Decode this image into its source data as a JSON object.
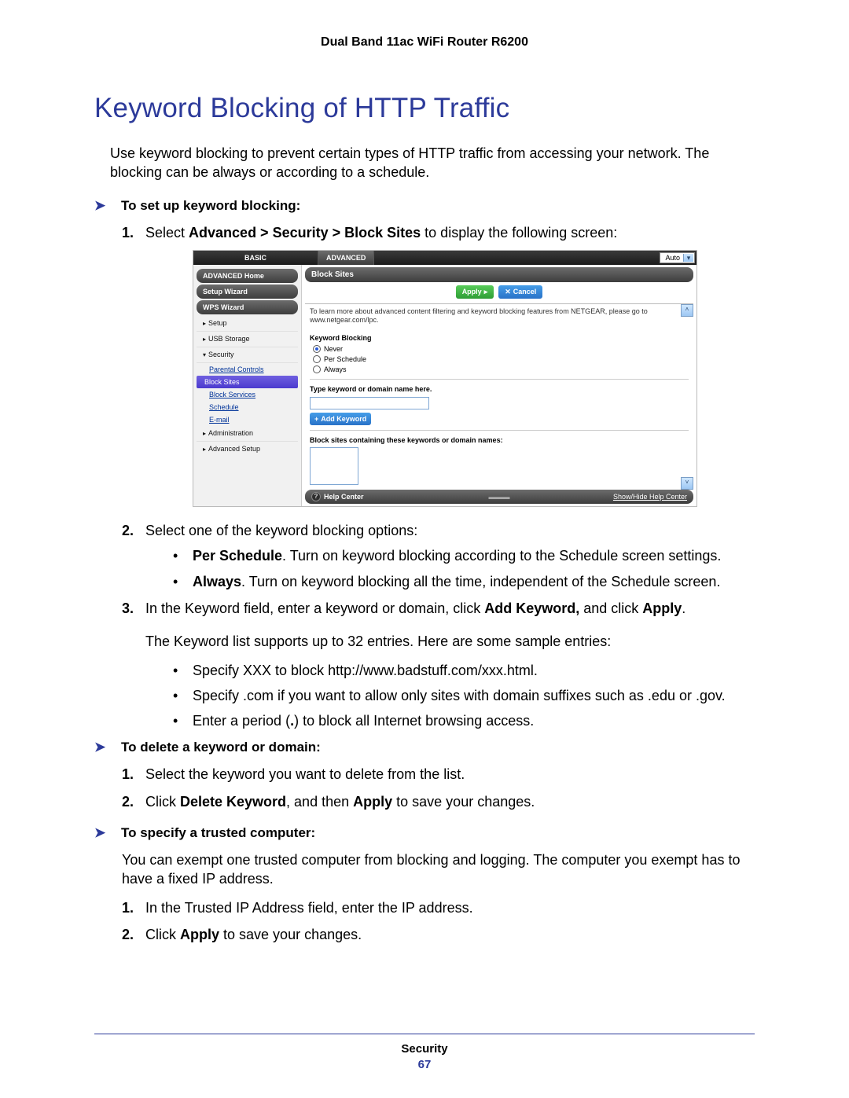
{
  "header": {
    "product": "Dual Band 11ac WiFi Router R6200"
  },
  "title": "Keyword Blocking of HTTP Traffic",
  "intro": "Use keyword blocking to prevent certain types of HTTP traffic from accessing your network. The blocking can be always or according to a schedule.",
  "proc1": {
    "heading": "To set up keyword blocking:",
    "step1_pre": "Select ",
    "step1_bold": "Advanced > Security > Block Sites",
    "step1_post": " to display the following screen:",
    "step2": "Select one of the keyword blocking options:",
    "b1_label": "Per Schedule",
    "b1_text": ". Turn on keyword blocking according to the Schedule screen settings.",
    "b2_label": "Always",
    "b2_text": ". Turn on keyword blocking all the time, independent of the Schedule screen.",
    "step3_pre": "In the Keyword field, enter a keyword or domain, click ",
    "step3_b1": "Add Keyword,",
    "step3_mid": " and click ",
    "step3_b2": "Apply",
    "step3_post": ".",
    "note": "The Keyword list supports up to 32 entries. Here are some sample entries:",
    "s1": "Specify XXX to block http://www.badstuff.com/xxx.html.",
    "s2": "Specify .com if you want to allow only sites with domain suffixes such as .edu or .gov.",
    "s3_pre": "Enter a period (",
    "s3_bold": ".",
    "s3_post": ") to block all Internet browsing access."
  },
  "proc2": {
    "heading": "To delete a keyword or domain:",
    "step1": "Select the keyword you want to delete from the list.",
    "step2_pre": "Click ",
    "step2_b1": "Delete Keyword",
    "step2_mid": ", and then ",
    "step2_b2": "Apply",
    "step2_post": " to save your changes."
  },
  "proc3": {
    "heading": "To specify a trusted computer:",
    "intro": "You can exempt one trusted computer from blocking and logging. The computer you exempt has to have a fixed IP address.",
    "step1": "In the Trusted IP Address field, enter the IP address.",
    "step2_pre": "Click ",
    "step2_bold": "Apply",
    "step2_post": " to save your changes."
  },
  "embed": {
    "tabs": {
      "basic": "BASIC",
      "advanced": "ADVANCED"
    },
    "auto": "Auto",
    "sidebar": {
      "home": "ADVANCED Home",
      "setup_wizard": "Setup Wizard",
      "wps": "WPS Wizard",
      "setup": "Setup",
      "usb": "USB Storage",
      "security": "Security",
      "sec_sub": {
        "parental": "Parental Controls",
        "block_sites": "Block Sites",
        "block_services": "Block Services",
        "schedule": "Schedule",
        "email": "E-mail"
      },
      "admin": "Administration",
      "adv_setup": "Advanced Setup"
    },
    "panel": {
      "title": "Block Sites",
      "apply": "Apply",
      "cancel": "Cancel",
      "info": "To learn more about advanced content filtering and keyword blocking features from NETGEAR, please go to www.netgear.com/lpc.",
      "kb_heading": "Keyword Blocking",
      "opt_never": "Never",
      "opt_per": "Per Schedule",
      "opt_always": "Always",
      "field_label": "Type keyword or domain name here.",
      "add_keyword": "Add Keyword",
      "block_list_label": "Block sites containing these keywords or domain names:"
    },
    "help": {
      "center": "Help Center",
      "show": "Show/Hide Help Center"
    }
  },
  "footer": {
    "chapter": "Security",
    "page": "67"
  }
}
